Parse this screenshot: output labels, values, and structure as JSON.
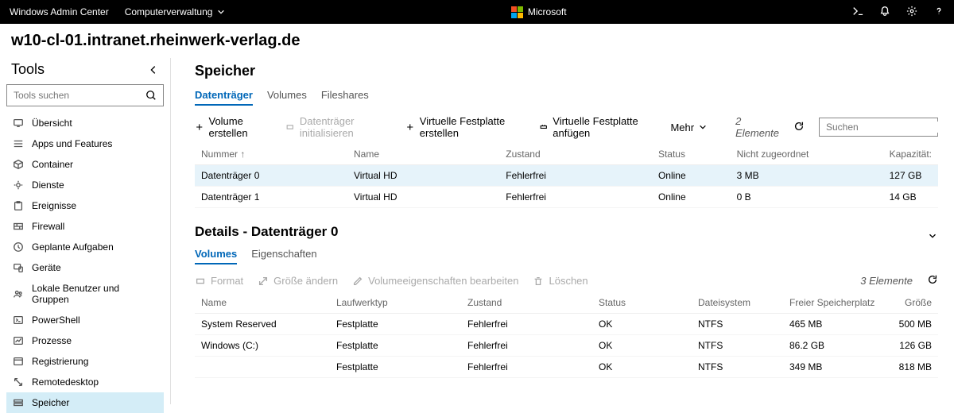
{
  "topbar": {
    "app": "Windows Admin Center",
    "context": "Computerverwaltung",
    "brand": "Microsoft"
  },
  "header": {
    "host": "w10-cl-01.intranet.rheinwerk-verlag.de"
  },
  "sidebar": {
    "title": "Tools",
    "search_placeholder": "Tools suchen",
    "items": [
      {
        "label": "Übersicht"
      },
      {
        "label": "Apps und Features"
      },
      {
        "label": "Container"
      },
      {
        "label": "Dienste"
      },
      {
        "label": "Ereignisse"
      },
      {
        "label": "Firewall"
      },
      {
        "label": "Geplante Aufgaben"
      },
      {
        "label": "Geräte"
      },
      {
        "label": "Lokale Benutzer und Gruppen"
      },
      {
        "label": "PowerShell"
      },
      {
        "label": "Prozesse"
      },
      {
        "label": "Registrierung"
      },
      {
        "label": "Remotedesktop"
      },
      {
        "label": "Speicher"
      }
    ]
  },
  "storage": {
    "title": "Speicher",
    "tabs": {
      "t0": "Datenträger",
      "t1": "Volumes",
      "t2": "Fileshares"
    },
    "toolbar": {
      "createVolume": "Volume erstellen",
      "initDisk": "Datenträger initialisieren",
      "createVhd": "Virtuelle Festplatte erstellen",
      "attachVhd": "Virtuelle Festplatte anfügen",
      "more": "Mehr",
      "count": "2 Elemente",
      "search_placeholder": "Suchen"
    },
    "cols": {
      "c0": "Nummer ↑",
      "c1": "Name",
      "c2": "Zustand",
      "c3": "Status",
      "c4": "Nicht zugeordnet",
      "c5": "Kapazität:"
    },
    "rows": [
      {
        "num": "Datenträger 0",
        "name": "Virtual HD",
        "state": "Fehlerfrei",
        "status": "Online",
        "unalloc": "3 MB",
        "cap": "127 GB"
      },
      {
        "num": "Datenträger 1",
        "name": "Virtual HD",
        "state": "Fehlerfrei",
        "status": "Online",
        "unalloc": "0 B",
        "cap": "14 GB"
      }
    ]
  },
  "details": {
    "title": "Details - Datenträger 0",
    "tabs": {
      "t0": "Volumes",
      "t1": "Eigenschaften"
    },
    "toolbar": {
      "format": "Format",
      "resize": "Größe ändern",
      "props": "Volumeeigenschaften bearbeiten",
      "delete": "Löschen",
      "count": "3 Elemente"
    },
    "cols": {
      "c0": "Name",
      "c1": "Laufwerktyp",
      "c2": "Zustand",
      "c3": "Status",
      "c4": "Dateisystem",
      "c5": "Freier Speicherplatz",
      "c6": "Größe"
    },
    "rows": [
      {
        "name": "System Reserved",
        "type": "Festplatte",
        "state": "Fehlerfrei",
        "status": "OK",
        "fs": "NTFS",
        "free": "465 MB",
        "size": "500 MB"
      },
      {
        "name": "Windows (C:)",
        "type": "Festplatte",
        "state": "Fehlerfrei",
        "status": "OK",
        "fs": "NTFS",
        "free": "86.2 GB",
        "size": "126 GB"
      },
      {
        "name": "",
        "type": "Festplatte",
        "state": "Fehlerfrei",
        "status": "OK",
        "fs": "NTFS",
        "free": "349 MB",
        "size": "818 MB"
      }
    ]
  }
}
